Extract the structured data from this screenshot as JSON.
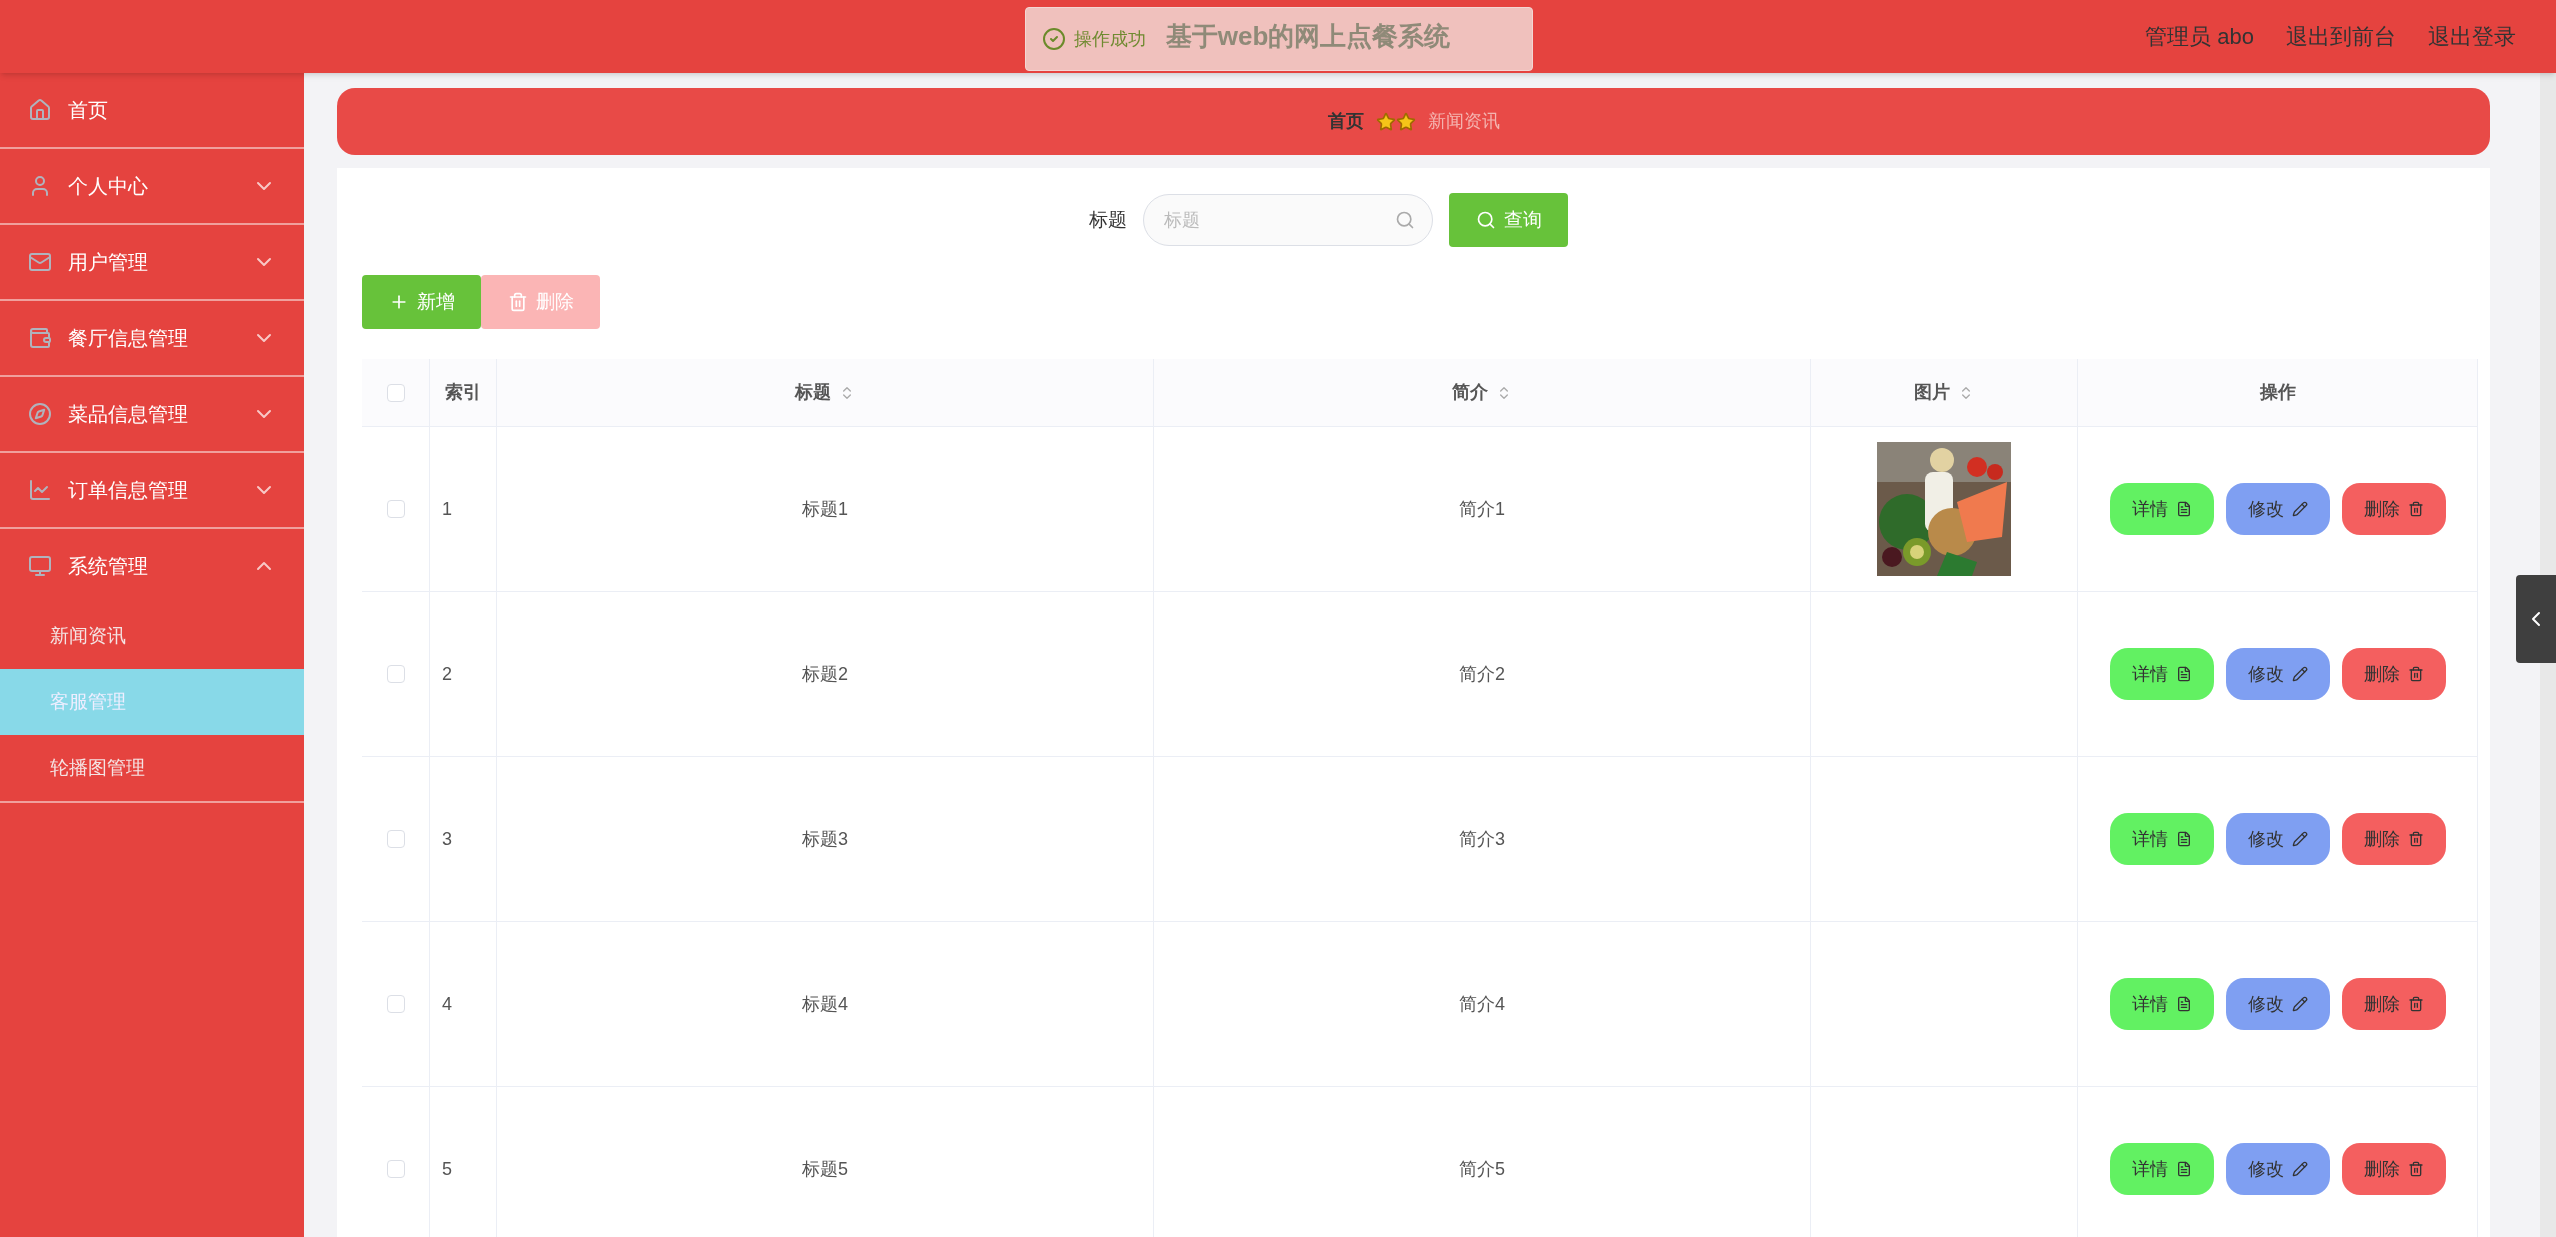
{
  "header": {
    "title": "基于web的网上点餐系统",
    "user": "管理员 abo",
    "links": [
      "退出到前台",
      "退出登录"
    ]
  },
  "toast": {
    "message": "操作成功"
  },
  "sidebar": {
    "items": [
      {
        "label": "首页"
      },
      {
        "label": "个人中心",
        "expanded": false
      },
      {
        "label": "用户管理",
        "expanded": false
      },
      {
        "label": "餐厅信息管理",
        "expanded": false
      },
      {
        "label": "菜品信息管理",
        "expanded": false
      },
      {
        "label": "订单信息管理",
        "expanded": false
      },
      {
        "label": "系统管理",
        "expanded": true,
        "children": [
          {
            "label": "新闻资讯",
            "selected": false
          },
          {
            "label": "客服管理",
            "selected": true
          },
          {
            "label": "轮播图管理",
            "selected": false
          }
        ]
      }
    ]
  },
  "breadcrumb": [
    {
      "label": "首页",
      "selected": false
    },
    {
      "label": "新闻资讯",
      "selected": true
    }
  ],
  "search": {
    "label": "标题",
    "placeholder": "标题",
    "button": "查询"
  },
  "toolbar": [
    {
      "label": "新增",
      "kind": "add",
      "disabled": false
    },
    {
      "label": "删除",
      "kind": "delete",
      "disabled": true
    }
  ],
  "table": {
    "select_all_checked": false,
    "columns": [
      {
        "label": "索引",
        "sortable": false
      },
      {
        "label": "标题",
        "sortable": true
      },
      {
        "label": "简介",
        "sortable": true
      },
      {
        "label": "图片",
        "sortable": true
      },
      {
        "label": "操作",
        "sortable": false
      }
    ],
    "rows": [
      {
        "index": "1",
        "title": "标题1",
        "summary": "简介1",
        "checked": false,
        "actions": [
          {
            "label": "详情",
            "kind": "detail"
          },
          {
            "label": "修改",
            "kind": "edit"
          },
          {
            "label": "删除",
            "kind": "delete"
          }
        ]
      },
      {
        "index": "2",
        "title": "标题2",
        "summary": "简介2",
        "checked": false,
        "actions": [
          {
            "label": "详情",
            "kind": "detail"
          },
          {
            "label": "修改",
            "kind": "edit"
          },
          {
            "label": "删除",
            "kind": "delete"
          }
        ]
      },
      {
        "index": "3",
        "title": "标题3",
        "summary": "简介3",
        "checked": false,
        "actions": [
          {
            "label": "详情",
            "kind": "detail"
          },
          {
            "label": "修改",
            "kind": "edit"
          },
          {
            "label": "删除",
            "kind": "delete"
          }
        ]
      },
      {
        "index": "4",
        "title": "标题4",
        "summary": "简介4",
        "checked": false,
        "actions": [
          {
            "label": "详情",
            "kind": "detail"
          },
          {
            "label": "修改",
            "kind": "edit"
          },
          {
            "label": "删除",
            "kind": "delete"
          }
        ]
      },
      {
        "index": "5",
        "title": "标题5",
        "summary": "简介5",
        "checked": false,
        "actions": [
          {
            "label": "详情",
            "kind": "detail"
          },
          {
            "label": "修改",
            "kind": "edit"
          },
          {
            "label": "删除",
            "kind": "delete"
          }
        ]
      }
    ]
  }
}
